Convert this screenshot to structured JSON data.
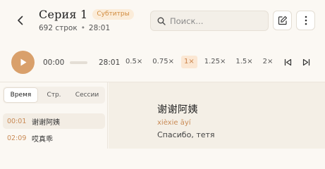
{
  "header": {
    "title": "Серия 1",
    "badge": "Субтитры",
    "line_count": "692 строк",
    "duration": "28:01"
  },
  "search": {
    "placeholder": "Поиск..."
  },
  "player": {
    "current_time": "00:00",
    "total_time": "28:01",
    "progress_fraction": 0,
    "speeds": [
      "0.5×",
      "0.75×",
      "1×",
      "1.25×",
      "1.5×",
      "2×"
    ],
    "active_speed": "1×"
  },
  "sidebar": {
    "tabs": [
      "Время",
      "Стр.",
      "Сессии"
    ],
    "active_tab": "Время",
    "items": [
      {
        "time": "00:01",
        "text": "谢谢阿姨"
      },
      {
        "time": "02:09",
        "text": "哎真乖"
      }
    ]
  },
  "main": {
    "hanzi": "谢谢阿姨",
    "pinyin": "xièxie āyí",
    "translation": "Спасибо, тетя"
  },
  "colors": {
    "accent": "#d9a06b",
    "accent_text": "#c98a55",
    "badge_bg": "#fbecd9"
  },
  "icons": [
    "chevron-left-icon",
    "search-icon",
    "edit-icon",
    "more-vertical-icon",
    "play-icon",
    "skip-previous-icon",
    "skip-next-icon"
  ]
}
